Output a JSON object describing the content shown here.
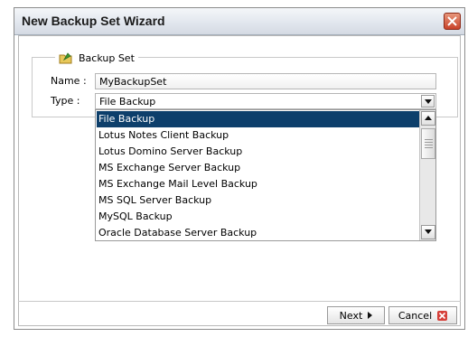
{
  "window": {
    "title": "New Backup Set Wizard",
    "close_icon": "close-icon",
    "accent": "#0d3f6b"
  },
  "group": {
    "legend": "Backup Set",
    "icon": "folder-arrow-icon"
  },
  "form": {
    "name_label": "Name :",
    "name_value": "MyBackupSet",
    "type_label": "Type :",
    "type_value": "File Backup"
  },
  "dropdown": {
    "items": [
      "File Backup",
      "Lotus Notes Client Backup",
      "Lotus Domino Server Backup",
      "MS Exchange Server Backup",
      "MS Exchange Mail Level Backup",
      "MS SQL Server Backup",
      "MySQL Backup",
      "Oracle Database Server Backup"
    ],
    "selected_index": 0
  },
  "buttons": {
    "next": "Next",
    "cancel": "Cancel"
  }
}
